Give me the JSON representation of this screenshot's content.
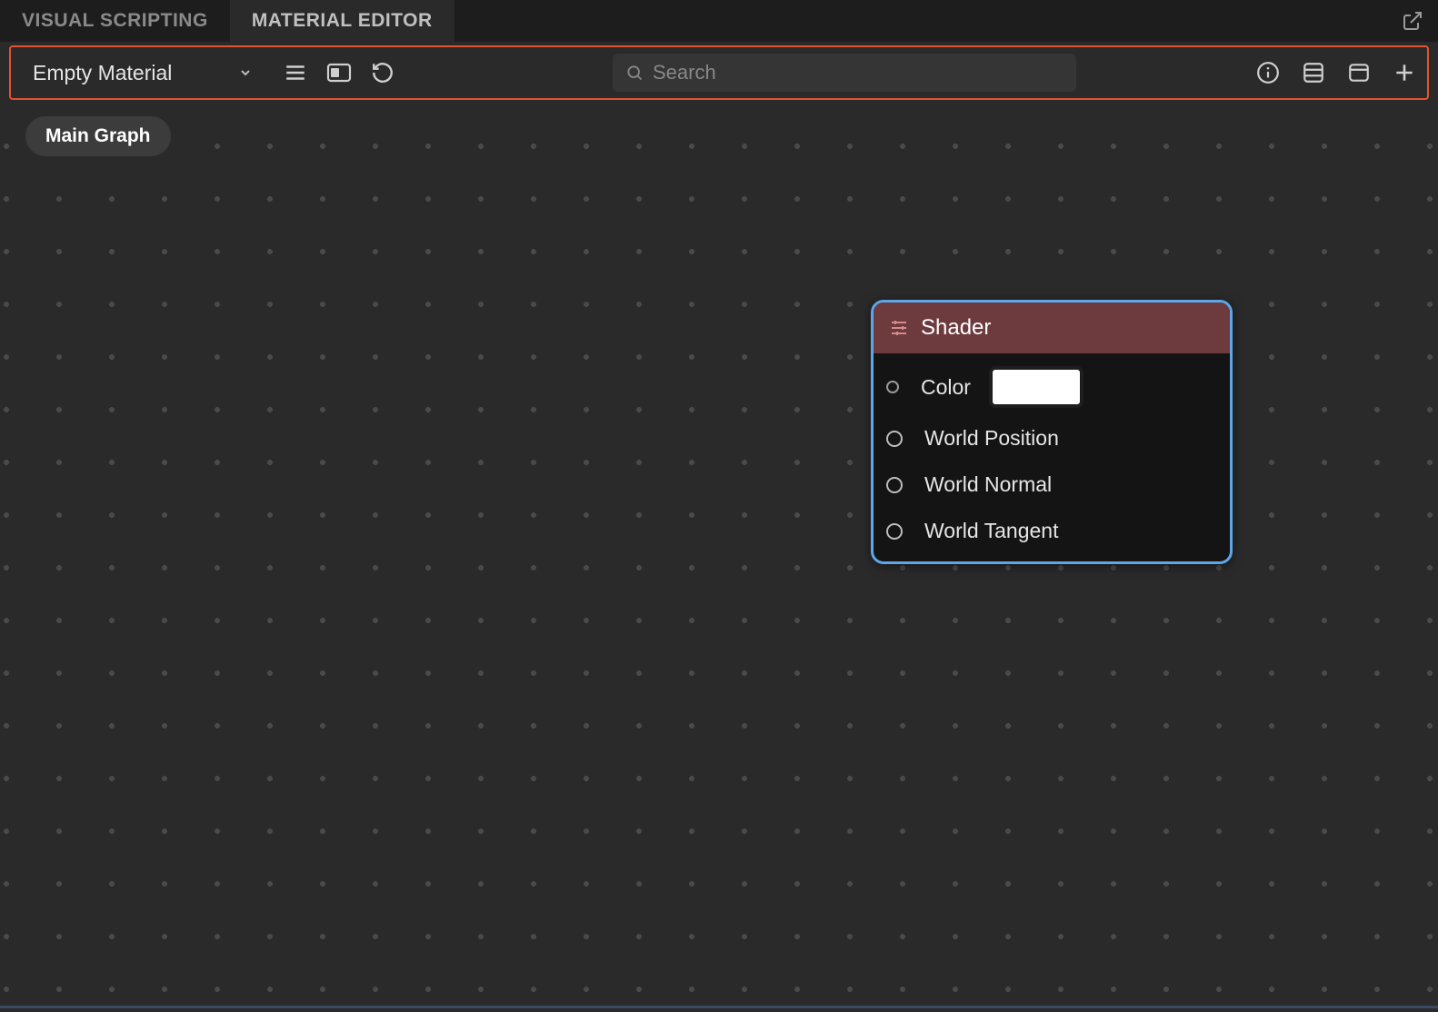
{
  "tabs": {
    "visual_scripting": "VISUAL SCRIPTING",
    "material_editor": "MATERIAL EDITOR"
  },
  "toolbar": {
    "material_name": "Empty Material",
    "search_placeholder": "Search"
  },
  "breadcrumb": {
    "label": "Main Graph"
  },
  "node": {
    "title": "Shader",
    "inputs": {
      "color": "Color",
      "world_position": "World Position",
      "world_normal": "World Normal",
      "world_tangent": "World Tangent"
    },
    "color_value": "#ffffff"
  }
}
